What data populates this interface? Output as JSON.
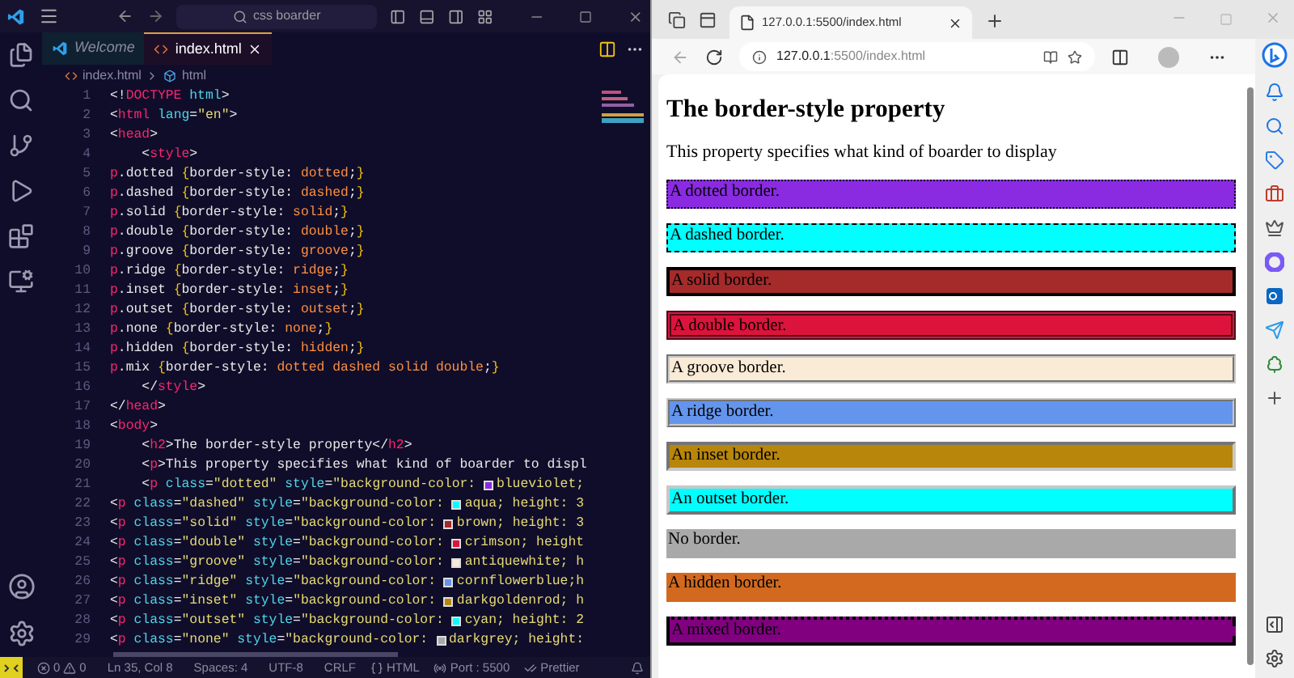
{
  "editor": {
    "search": "css boarder",
    "tabs": [
      {
        "label": "Welcome",
        "selected": false,
        "kind": "welcome"
      },
      {
        "label": "index.html",
        "selected": true,
        "kind": "html"
      }
    ],
    "breadcrumb": [
      "index.html",
      "html"
    ],
    "lines": [
      {
        "number": "1",
        "tokens": [
          {
            "kind": "punct",
            "t": "<!"
          },
          {
            "kind": "tag",
            "t": "DOCTYPE"
          },
          {
            "kind": "attr",
            "t": " html"
          },
          {
            "kind": "punct",
            "t": ">"
          }
        ]
      },
      {
        "number": "2",
        "tokens": [
          {
            "kind": "punct",
            "t": "<"
          },
          {
            "kind": "tag",
            "t": "html"
          },
          {
            "kind": "attr",
            "t": " lang"
          },
          {
            "kind": "punct",
            "t": "="
          },
          {
            "kind": "str",
            "t": "\"en\""
          },
          {
            "kind": "punct",
            "t": ">"
          }
        ]
      },
      {
        "number": "3",
        "tokens": [
          {
            "kind": "punct",
            "t": "<"
          },
          {
            "kind": "tag",
            "t": "head"
          },
          {
            "kind": "punct",
            "t": ">"
          }
        ]
      },
      {
        "number": "4",
        "tokens": [
          {
            "kind": "punct",
            "t": "    <"
          },
          {
            "kind": "tag",
            "t": "style"
          },
          {
            "kind": "punct",
            "t": ">"
          }
        ]
      },
      {
        "number": "5",
        "tokens": [
          {
            "kind": "tag",
            "t": "p"
          },
          {
            "kind": "punct",
            "t": ".dotted "
          },
          {
            "kind": "brace",
            "t": "{"
          },
          {
            "kind": "punct",
            "t": "border-style: "
          },
          {
            "kind": "val",
            "t": "dotted"
          },
          {
            "kind": "punct",
            "t": ";"
          },
          {
            "kind": "brace",
            "t": "}"
          }
        ]
      },
      {
        "number": "6",
        "tokens": [
          {
            "kind": "tag",
            "t": "p"
          },
          {
            "kind": "punct",
            "t": ".dashed "
          },
          {
            "kind": "brace",
            "t": "{"
          },
          {
            "kind": "punct",
            "t": "border-style: "
          },
          {
            "kind": "val",
            "t": "dashed"
          },
          {
            "kind": "punct",
            "t": ";"
          },
          {
            "kind": "brace",
            "t": "}"
          }
        ]
      },
      {
        "number": "7",
        "tokens": [
          {
            "kind": "tag",
            "t": "p"
          },
          {
            "kind": "punct",
            "t": ".solid "
          },
          {
            "kind": "brace",
            "t": "{"
          },
          {
            "kind": "punct",
            "t": "border-style: "
          },
          {
            "kind": "val",
            "t": "solid"
          },
          {
            "kind": "punct",
            "t": ";"
          },
          {
            "kind": "brace",
            "t": "}"
          }
        ]
      },
      {
        "number": "8",
        "tokens": [
          {
            "kind": "tag",
            "t": "p"
          },
          {
            "kind": "punct",
            "t": ".double "
          },
          {
            "kind": "brace",
            "t": "{"
          },
          {
            "kind": "punct",
            "t": "border-style: "
          },
          {
            "kind": "val",
            "t": "double"
          },
          {
            "kind": "punct",
            "t": ";"
          },
          {
            "kind": "brace",
            "t": "}"
          }
        ]
      },
      {
        "number": "9",
        "tokens": [
          {
            "kind": "tag",
            "t": "p"
          },
          {
            "kind": "punct",
            "t": ".groove "
          },
          {
            "kind": "brace",
            "t": "{"
          },
          {
            "kind": "punct",
            "t": "border-style: "
          },
          {
            "kind": "val",
            "t": "groove"
          },
          {
            "kind": "punct",
            "t": ";"
          },
          {
            "kind": "brace",
            "t": "}"
          }
        ]
      },
      {
        "number": "10",
        "tokens": [
          {
            "kind": "tag",
            "t": "p"
          },
          {
            "kind": "punct",
            "t": ".ridge "
          },
          {
            "kind": "brace",
            "t": "{"
          },
          {
            "kind": "punct",
            "t": "border-style: "
          },
          {
            "kind": "val",
            "t": "ridge"
          },
          {
            "kind": "punct",
            "t": ";"
          },
          {
            "kind": "brace",
            "t": "}"
          }
        ]
      },
      {
        "number": "11",
        "tokens": [
          {
            "kind": "tag",
            "t": "p"
          },
          {
            "kind": "punct",
            "t": ".inset "
          },
          {
            "kind": "brace",
            "t": "{"
          },
          {
            "kind": "punct",
            "t": "border-style: "
          },
          {
            "kind": "val",
            "t": "inset"
          },
          {
            "kind": "punct",
            "t": ";"
          },
          {
            "kind": "brace",
            "t": "}"
          }
        ]
      },
      {
        "number": "12",
        "tokens": [
          {
            "kind": "tag",
            "t": "p"
          },
          {
            "kind": "punct",
            "t": ".outset "
          },
          {
            "kind": "brace",
            "t": "{"
          },
          {
            "kind": "punct",
            "t": "border-style: "
          },
          {
            "kind": "val",
            "t": "outset"
          },
          {
            "kind": "punct",
            "t": ";"
          },
          {
            "kind": "brace",
            "t": "}"
          }
        ]
      },
      {
        "number": "13",
        "tokens": [
          {
            "kind": "tag",
            "t": "p"
          },
          {
            "kind": "punct",
            "t": ".none "
          },
          {
            "kind": "brace",
            "t": "{"
          },
          {
            "kind": "punct",
            "t": "border-style: "
          },
          {
            "kind": "val",
            "t": "none"
          },
          {
            "kind": "punct",
            "t": ";"
          },
          {
            "kind": "brace",
            "t": "}"
          }
        ]
      },
      {
        "number": "14",
        "tokens": [
          {
            "kind": "tag",
            "t": "p"
          },
          {
            "kind": "punct",
            "t": ".hidden "
          },
          {
            "kind": "brace",
            "t": "{"
          },
          {
            "kind": "punct",
            "t": "border-style: "
          },
          {
            "kind": "val",
            "t": "hidden"
          },
          {
            "kind": "punct",
            "t": ";"
          },
          {
            "kind": "brace",
            "t": "}"
          }
        ]
      },
      {
        "number": "15",
        "tokens": [
          {
            "kind": "tag",
            "t": "p"
          },
          {
            "kind": "punct",
            "t": ".mix "
          },
          {
            "kind": "brace",
            "t": "{"
          },
          {
            "kind": "punct",
            "t": "border-style: "
          },
          {
            "kind": "val",
            "t": "dotted dashed solid double"
          },
          {
            "kind": "punct",
            "t": ";"
          },
          {
            "kind": "brace",
            "t": "}"
          }
        ]
      },
      {
        "number": "16",
        "tokens": [
          {
            "kind": "punct",
            "t": "    </"
          },
          {
            "kind": "tag",
            "t": "style"
          },
          {
            "kind": "punct",
            "t": ">"
          }
        ]
      },
      {
        "number": "17",
        "tokens": [
          {
            "kind": "punct",
            "t": "</"
          },
          {
            "kind": "tag",
            "t": "head"
          },
          {
            "kind": "punct",
            "t": ">"
          }
        ]
      },
      {
        "number": "18",
        "tokens": [
          {
            "kind": "punct",
            "t": "<"
          },
          {
            "kind": "tag",
            "t": "body"
          },
          {
            "kind": "punct",
            "t": ">"
          }
        ]
      },
      {
        "number": "19",
        "tokens": [
          {
            "kind": "punct",
            "t": "    <"
          },
          {
            "kind": "tag",
            "t": "h2"
          },
          {
            "kind": "punct",
            "t": ">The border-style property</"
          },
          {
            "kind": "tag",
            "t": "h2"
          },
          {
            "kind": "punct",
            "t": ">"
          }
        ]
      },
      {
        "number": "20",
        "tokens": [
          {
            "kind": "punct",
            "t": "    <"
          },
          {
            "kind": "tag",
            "t": "p"
          },
          {
            "kind": "punct",
            "t": ">This property specifies what kind of boarder to displ"
          }
        ]
      },
      {
        "number": "21",
        "tokens": [
          {
            "kind": "punct",
            "t": "    <"
          },
          {
            "kind": "tag",
            "t": "p"
          },
          {
            "kind": "attr",
            "t": " class"
          },
          {
            "kind": "punct",
            "t": "="
          },
          {
            "kind": "str",
            "t": "\"dotted\""
          },
          {
            "kind": "attr",
            "t": " style"
          },
          {
            "kind": "punct",
            "t": "="
          },
          {
            "kind": "str",
            "t": "\"background-color: "
          },
          {
            "kind": "swatch",
            "color": "#8a2be2"
          },
          {
            "kind": "str",
            "t": "blueviolet;"
          }
        ]
      },
      {
        "number": "22",
        "tokens": [
          {
            "kind": "punct",
            "t": "<"
          },
          {
            "kind": "tag",
            "t": "p"
          },
          {
            "kind": "attr",
            "t": " class"
          },
          {
            "kind": "punct",
            "t": "="
          },
          {
            "kind": "str",
            "t": "\"dashed\""
          },
          {
            "kind": "attr",
            "t": " style"
          },
          {
            "kind": "punct",
            "t": "="
          },
          {
            "kind": "str",
            "t": "\"background-color: "
          },
          {
            "kind": "swatch",
            "color": "#00ffff"
          },
          {
            "kind": "str",
            "t": "aqua; height: 3"
          }
        ]
      },
      {
        "number": "23",
        "tokens": [
          {
            "kind": "punct",
            "t": "<"
          },
          {
            "kind": "tag",
            "t": "p"
          },
          {
            "kind": "attr",
            "t": " class"
          },
          {
            "kind": "punct",
            "t": "="
          },
          {
            "kind": "str",
            "t": "\"solid\""
          },
          {
            "kind": "attr",
            "t": " style"
          },
          {
            "kind": "punct",
            "t": "="
          },
          {
            "kind": "str",
            "t": "\"background-color: "
          },
          {
            "kind": "swatch",
            "color": "#a52a2a"
          },
          {
            "kind": "str",
            "t": "brown; height: 3"
          }
        ]
      },
      {
        "number": "24",
        "tokens": [
          {
            "kind": "punct",
            "t": "<"
          },
          {
            "kind": "tag",
            "t": "p"
          },
          {
            "kind": "attr",
            "t": " class"
          },
          {
            "kind": "punct",
            "t": "="
          },
          {
            "kind": "str",
            "t": "\"double\""
          },
          {
            "kind": "attr",
            "t": " style"
          },
          {
            "kind": "punct",
            "t": "="
          },
          {
            "kind": "str",
            "t": "\"background-color: "
          },
          {
            "kind": "swatch",
            "color": "#dc143c"
          },
          {
            "kind": "str",
            "t": "crimson; height"
          }
        ]
      },
      {
        "number": "25",
        "tokens": [
          {
            "kind": "punct",
            "t": "<"
          },
          {
            "kind": "tag",
            "t": "p"
          },
          {
            "kind": "attr",
            "t": " class"
          },
          {
            "kind": "punct",
            "t": "="
          },
          {
            "kind": "str",
            "t": "\"groove\""
          },
          {
            "kind": "attr",
            "t": " style"
          },
          {
            "kind": "punct",
            "t": "="
          },
          {
            "kind": "str",
            "t": "\"background-color: "
          },
          {
            "kind": "swatch",
            "color": "#faebd7"
          },
          {
            "kind": "str",
            "t": "antiquewhite; h"
          }
        ]
      },
      {
        "number": "26",
        "tokens": [
          {
            "kind": "punct",
            "t": "<"
          },
          {
            "kind": "tag",
            "t": "p"
          },
          {
            "kind": "attr",
            "t": " class"
          },
          {
            "kind": "punct",
            "t": "="
          },
          {
            "kind": "str",
            "t": "\"ridge\""
          },
          {
            "kind": "attr",
            "t": " style"
          },
          {
            "kind": "punct",
            "t": "="
          },
          {
            "kind": "str",
            "t": "\"background-color: "
          },
          {
            "kind": "swatch",
            "color": "#6495ed"
          },
          {
            "kind": "str",
            "t": "cornflowerblue;h"
          }
        ]
      },
      {
        "number": "27",
        "tokens": [
          {
            "kind": "punct",
            "t": "<"
          },
          {
            "kind": "tag",
            "t": "p"
          },
          {
            "kind": "attr",
            "t": " class"
          },
          {
            "kind": "punct",
            "t": "="
          },
          {
            "kind": "str",
            "t": "\"inset\""
          },
          {
            "kind": "attr",
            "t": " style"
          },
          {
            "kind": "punct",
            "t": "="
          },
          {
            "kind": "str",
            "t": "\"background-color: "
          },
          {
            "kind": "swatch",
            "color": "#b8860b"
          },
          {
            "kind": "str",
            "t": "darkgoldenrod; h"
          }
        ]
      },
      {
        "number": "28",
        "tokens": [
          {
            "kind": "punct",
            "t": "<"
          },
          {
            "kind": "tag",
            "t": "p"
          },
          {
            "kind": "attr",
            "t": " class"
          },
          {
            "kind": "punct",
            "t": "="
          },
          {
            "kind": "str",
            "t": "\"outset\""
          },
          {
            "kind": "attr",
            "t": " style"
          },
          {
            "kind": "punct",
            "t": "="
          },
          {
            "kind": "str",
            "t": "\"background-color: "
          },
          {
            "kind": "swatch",
            "color": "#00ffff"
          },
          {
            "kind": "str",
            "t": "cyan; height: 2"
          }
        ]
      },
      {
        "number": "29",
        "tokens": [
          {
            "kind": "punct",
            "t": "<"
          },
          {
            "kind": "tag",
            "t": "p"
          },
          {
            "kind": "attr",
            "t": " class"
          },
          {
            "kind": "punct",
            "t": "="
          },
          {
            "kind": "str",
            "t": "\"none\""
          },
          {
            "kind": "attr",
            "t": " style"
          },
          {
            "kind": "punct",
            "t": "="
          },
          {
            "kind": "str",
            "t": "\"background-color: "
          },
          {
            "kind": "swatch",
            "color": "#a9a9a9"
          },
          {
            "kind": "str",
            "t": "darkgrey; height:"
          }
        ]
      }
    ],
    "status_bar": {
      "errors": "0",
      "warnings": "0",
      "items": [
        "Ln 35, Col 8",
        "Spaces: 4",
        "UTF-8",
        "CRLF"
      ],
      "language": "HTML",
      "port": "Port : 5500",
      "formatter": "Prettier"
    }
  },
  "browser": {
    "tab": "127.0.0.1:5500/index.html",
    "address_host": "127.0.0.1",
    "address_path": ":5500/index.html",
    "page": {
      "heading": "The border-style property",
      "intro": "This property specifies what kind of boarder to display",
      "boxes": [
        {
          "text": "A dotted border.",
          "color": "#8a2be2",
          "kind": "dotted"
        },
        {
          "text": "A dashed border.",
          "color": "#00ffff",
          "kind": "dashed"
        },
        {
          "text": "A solid border.",
          "color": "#a52a2a",
          "kind": "solid"
        },
        {
          "text": "A double border.",
          "color": "#dc143c",
          "kind": "double"
        },
        {
          "text": "A groove border.",
          "color": "#faebd7",
          "kind": "groove"
        },
        {
          "text": "A ridge border.",
          "color": "#6495ed",
          "kind": "ridge"
        },
        {
          "text": "An inset border.",
          "color": "#b8860b",
          "kind": "inset"
        },
        {
          "text": "An outset border.",
          "color": "#00ffff",
          "kind": "outset"
        },
        {
          "text": "No border.",
          "color": "#a9a9a9",
          "kind": "none"
        },
        {
          "text": "A hidden border.",
          "color": "#d2691e",
          "kind": "hidden"
        },
        {
          "text": "A mixed border.",
          "color": "#800080",
          "kind": "mix"
        }
      ]
    }
  }
}
